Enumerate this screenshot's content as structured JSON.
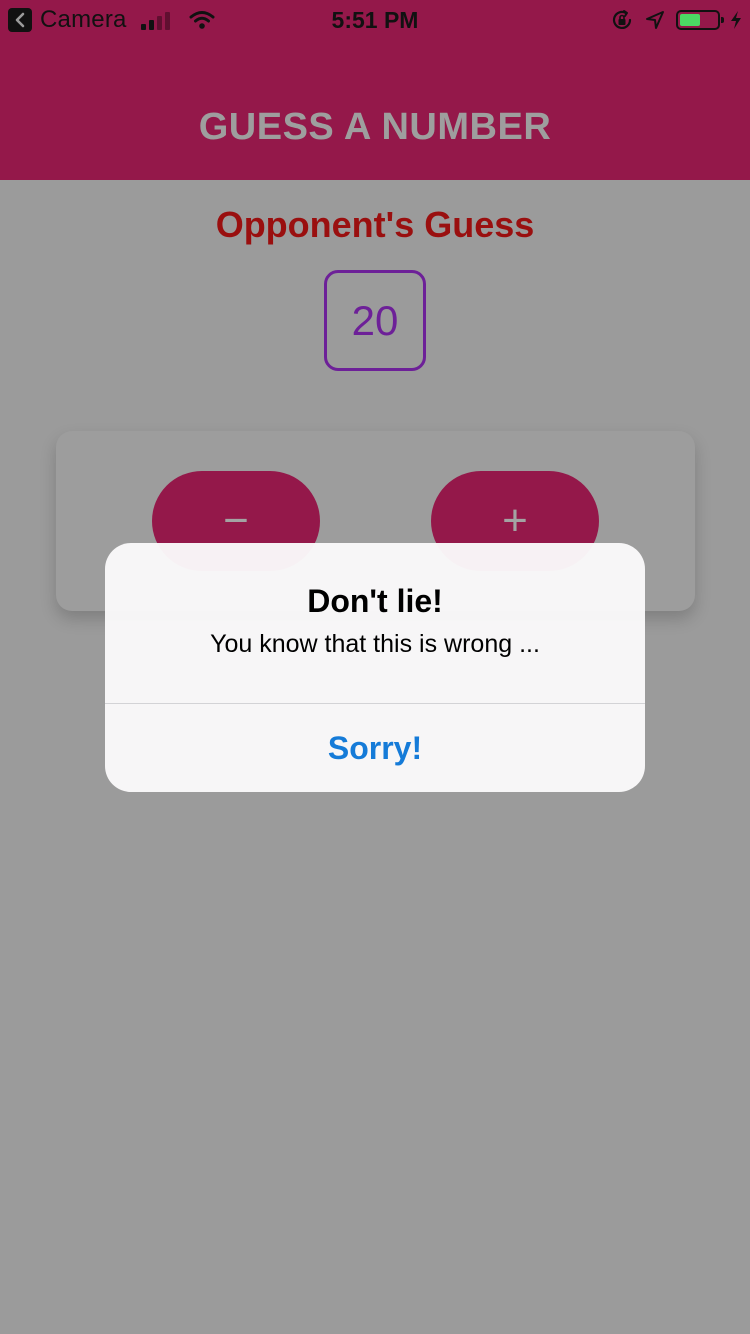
{
  "status_bar": {
    "back_label": "Camera",
    "time": "5:51 PM",
    "battery_level": 0.55
  },
  "header": {
    "title": "GUESS A NUMBER"
  },
  "game": {
    "opponent_title": "Opponent's Guess",
    "guess_value": "20",
    "minus_label": "−",
    "plus_label": "+"
  },
  "alert": {
    "title": "Don't lie!",
    "message": "You know that this is wrong ...",
    "action_label": "Sorry!"
  },
  "colors": {
    "primary": "#94184a",
    "accent": "#6d2098",
    "title_red": "#9a0f0f",
    "link_blue": "#157bd8"
  }
}
